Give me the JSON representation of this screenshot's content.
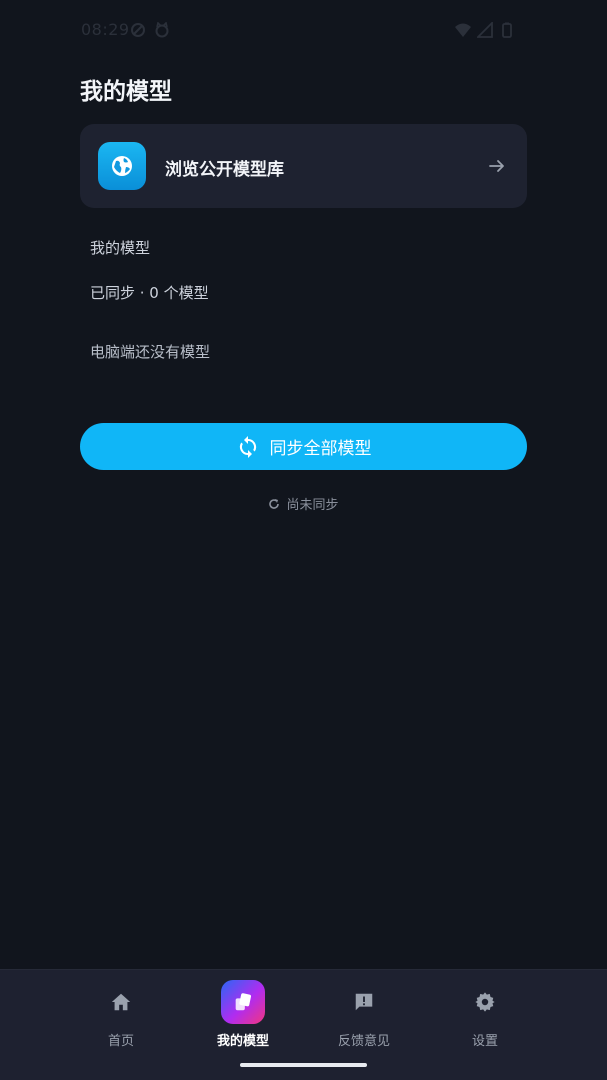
{
  "status_bar": {
    "time": "08:29",
    "left_icons": [
      "do-not-disturb-icon",
      "cat-face-icon"
    ],
    "right_icons": [
      "wifi-icon",
      "signal-icon",
      "battery-icon"
    ]
  },
  "page": {
    "title": "我的模型"
  },
  "browse_card": {
    "label": "浏览公开模型库",
    "icon": "globe-icon",
    "action_icon": "arrow-right-icon"
  },
  "my_models": {
    "section_title": "我的模型",
    "sync_summary": "已同步 · 0 个模型",
    "empty_message": "电脑端还没有模型"
  },
  "sync": {
    "button_label": "同步全部模型",
    "button_icon": "sync-icon",
    "status_text": "尚未同步",
    "status_icon": "refresh-icon"
  },
  "bottom_nav": {
    "items": [
      {
        "label": "首页",
        "icon": "home-icon",
        "active": false
      },
      {
        "label": "我的模型",
        "icon": "models-icon",
        "active": true
      },
      {
        "label": "反馈意见",
        "icon": "feedback-icon",
        "active": false
      },
      {
        "label": "设置",
        "icon": "gear-icon",
        "active": false
      }
    ]
  },
  "colors": {
    "background": "#11151d",
    "card": "#1e2230",
    "accent": "#10b6f7",
    "nav_background": "#1e2130"
  }
}
